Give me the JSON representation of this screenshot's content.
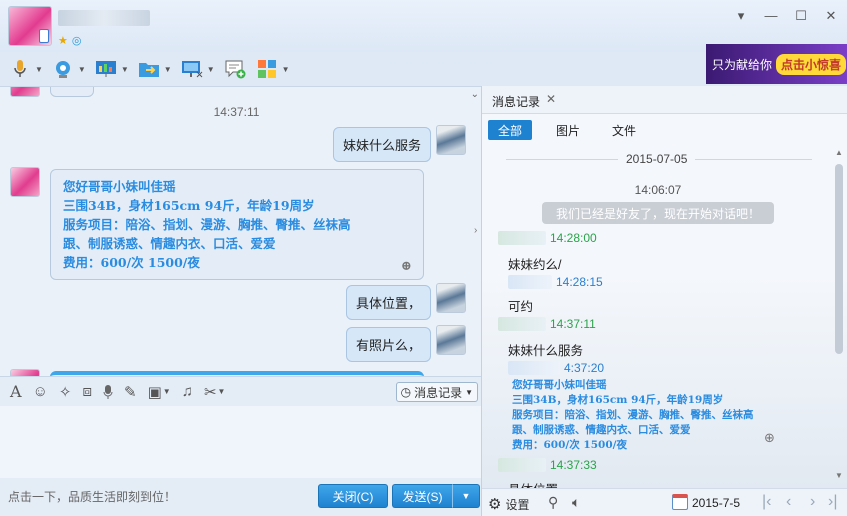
{
  "window": {
    "controls": {
      "dropdown": "▾",
      "minimize": "—",
      "maximize": "☐",
      "close": "✕"
    }
  },
  "banner": {
    "text": "只为献给你",
    "highlight": "点击小惊喜"
  },
  "chat": {
    "messages": [
      {
        "type": "time",
        "text": "14:37:11"
      },
      {
        "type": "out",
        "text": "妹妹什么服务"
      },
      {
        "type": "in_rich",
        "lines": [
          "您好哥哥小妹叫佳瑶",
          "三围34B，身材165cm 94斤，年龄19周岁",
          "服务项目：陪浴、指划、漫游、胸推、臀推、丝袜高",
          "跟、制服诱惑、情趣内衣、口活、爱爱",
          "费用：600/次  1500/夜"
        ]
      },
      {
        "type": "out",
        "text": "具体位置，"
      },
      {
        "type": "out",
        "text": "有照片么，"
      }
    ]
  },
  "input": {
    "history_button": "消息记录",
    "tip": "点击一下，品质生活即刻到位！",
    "close_button": "关闭(C)",
    "send_button": "发送(S)"
  },
  "history": {
    "tab_title": "消息记录",
    "filters": [
      "全部",
      "图片",
      "文件"
    ],
    "date_header": "2015-07-05",
    "first_time": "14:06:07",
    "system_message": "我们已经是好友了，现在开始对话吧！",
    "entries": [
      {
        "time": "14:28:00",
        "text": "妹妹约么/"
      },
      {
        "time": "14:28:15",
        "text": "可约"
      },
      {
        "time": "14:37:11",
        "text": "妹妹什么服务"
      },
      {
        "time": "4:37:20"
      },
      {
        "time": "14:37:33",
        "text": "具体位置"
      }
    ],
    "rich_lines": [
      "您好哥哥小妹叫佳瑶",
      "三围34B，身材165cm 94斤，年龄19周岁",
      "服务项目：陪浴、指划、漫游、胸推、臀推、丝袜高",
      "跟、制服诱惑、情趣内衣、口活、爱爱",
      "费用：600/次  1500/夜"
    ],
    "settings_label": "设置",
    "current_date": "2015-7-5"
  }
}
